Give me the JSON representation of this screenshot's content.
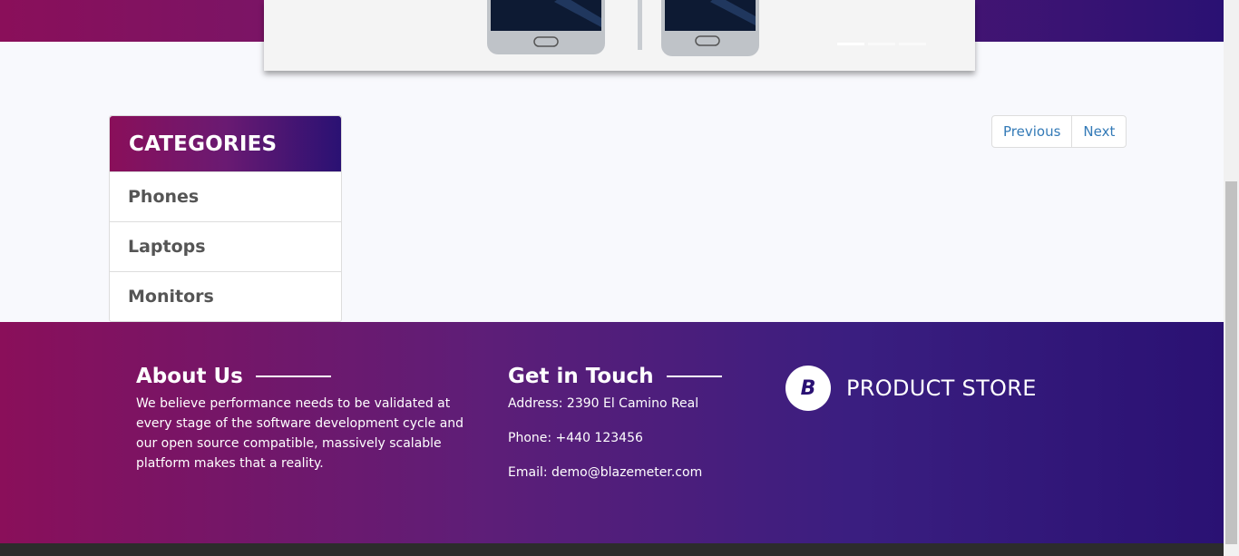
{
  "carousel": {
    "slides": 3,
    "active_index": 0,
    "image_icon": "phone-product-image"
  },
  "categories": {
    "title": "CATEGORIES",
    "items": [
      {
        "label": "Phones"
      },
      {
        "label": "Laptops"
      },
      {
        "label": "Monitors"
      }
    ]
  },
  "pagination": {
    "previous_label": "Previous",
    "next_label": "Next"
  },
  "footer": {
    "about": {
      "title": "About Us",
      "text": "We believe performance needs to be validated at every stage of the software development cycle and our open source compatible, massively scalable platform makes that a reality."
    },
    "contact": {
      "title": "Get in Touch",
      "address": "Address: 2390 El Camino Real",
      "phone": "Phone: +440 123456",
      "email": "Email: demo@blazemeter.com"
    },
    "brand": {
      "name": "PRODUCT STORE",
      "logo_letter": "B"
    }
  },
  "colors": {
    "gradient_start": "#8a0f5a",
    "gradient_end": "#2a1173",
    "link": "#337ab7"
  }
}
